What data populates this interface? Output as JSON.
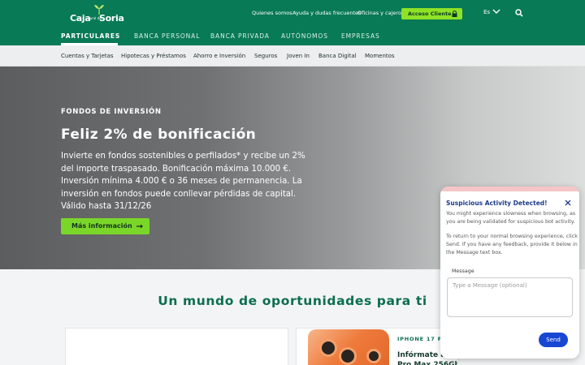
{
  "header": {
    "logo": {
      "word1": "Caja",
      "word2": "rural de",
      "word3": "Soria"
    },
    "top_links": [
      "Quienes somos",
      "Ayuda y dudas frecuentes",
      "Oficinas y cajeros"
    ],
    "access_button": "Acceso Cliente",
    "language": "Es",
    "main_nav": [
      "PARTICULARES",
      "BANCA PERSONAL",
      "BANCA PRIVADA",
      "AUTÓNOMOS",
      "EMPRESAS"
    ],
    "active_nav": "PARTICULARES"
  },
  "subnav": [
    "Cuentas y Tarjetas",
    "Hipotecas y Préstamos",
    "Ahorro e Inversión",
    "Seguros",
    "Joven In",
    "Banca Digital",
    "Momentos"
  ],
  "hero": {
    "kicker": "FONDOS DE INVERSIÓN",
    "title": "Feliz 2% de bonificación",
    "body": "Invierte en fondos sostenibles o perfilados* y recibe un 2% del importe traspasado. Bonificación máxima 10.000 €. Inversión mínima 4.000 € o 36 meses de permanencia. La inversión en fondos puede conllevar pérdidas de capital. Válido hasta 31/12/26",
    "button": "Más información"
  },
  "section": {
    "title": "Un mundo de oportunidades para ti",
    "card2": {
      "kicker": "IPHONE 17 PRO",
      "text": "Infórmate ac tu iPhone 17 Pro Max 256Gb"
    }
  },
  "popup": {
    "title": "Suspicious Activity Detected!",
    "paragraph1": "You might experience slowness when browsing, as you are being validated for suspicious bot activity.",
    "paragraph2": "To return to your normal browsing experience, click Send. If you have any feedback, provide it below in the Message text box.",
    "message_label": "Message",
    "message_placeholder": "Type a Message (optional)",
    "send_button": "Send"
  },
  "colors": {
    "brand_green": "#087a55",
    "accent_lime": "#8fe226",
    "popup_blue": "#1947d4",
    "section_title_green": "#0b6e4e"
  },
  "icons": [
    "logo-sprout-icon",
    "lock-icon",
    "chevron-down-icon",
    "search-icon",
    "arrow-right-icon",
    "close-icon"
  ]
}
